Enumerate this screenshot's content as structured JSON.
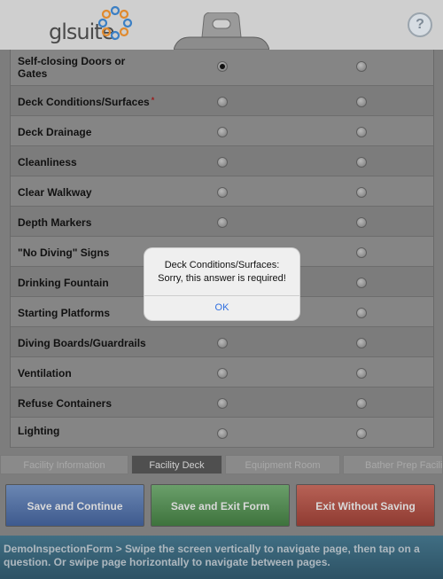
{
  "brand": {
    "name": "glsuite"
  },
  "header": {
    "help_icon": "question-icon",
    "help_label": "?"
  },
  "questions": [
    {
      "label": "Self-closing Doors or Gates",
      "required": false,
      "selected": 0
    },
    {
      "label": "Deck Conditions/Surfaces",
      "required": true,
      "selected": null
    },
    {
      "label": "Deck Drainage",
      "required": false,
      "selected": null
    },
    {
      "label": "Cleanliness",
      "required": false,
      "selected": null
    },
    {
      "label": "Clear Walkway",
      "required": false,
      "selected": null
    },
    {
      "label": "Depth Markers",
      "required": false,
      "selected": null
    },
    {
      "label": "\"No Diving\" Signs",
      "required": false,
      "selected": null
    },
    {
      "label": "Drinking Fountain",
      "required": false,
      "selected": null
    },
    {
      "label": "Starting Platforms",
      "required": false,
      "selected": null
    },
    {
      "label": "Diving Boards/Guardrails",
      "required": false,
      "selected": null
    },
    {
      "label": "Ventilation",
      "required": false,
      "selected": null
    },
    {
      "label": "Refuse Containers",
      "required": false,
      "selected": null
    },
    {
      "label": "Lighting",
      "required": false,
      "selected": null
    }
  ],
  "required_marker": "*",
  "tabs": [
    {
      "label": "Facility Information",
      "active": false
    },
    {
      "label": "Facility Deck",
      "active": true
    },
    {
      "label": "Equipment Room",
      "active": false
    },
    {
      "label": "Bather Prep Facili",
      "active": false
    }
  ],
  "buttons": {
    "save_continue": "Save and Continue",
    "save_exit": "Save and Exit Form",
    "exit_no_save": "Exit Without Saving"
  },
  "status": {
    "text": "DemoInspectionForm > Swipe the screen vertically to navigate page, then tap on a question. Or swipe page horizontally to navigate between pages."
  },
  "dialog": {
    "line1": "Deck Conditions/Surfaces:",
    "line2": "Sorry, this answer is required!",
    "ok": "OK"
  },
  "colors": {
    "header": "#cfcfcf",
    "save_continue": "#4f6fa3",
    "save_exit": "#4f8a4f",
    "exit_no_save": "#a3493f",
    "status_bar": "#36606f",
    "dialog_ok": "#2e6ee0"
  }
}
